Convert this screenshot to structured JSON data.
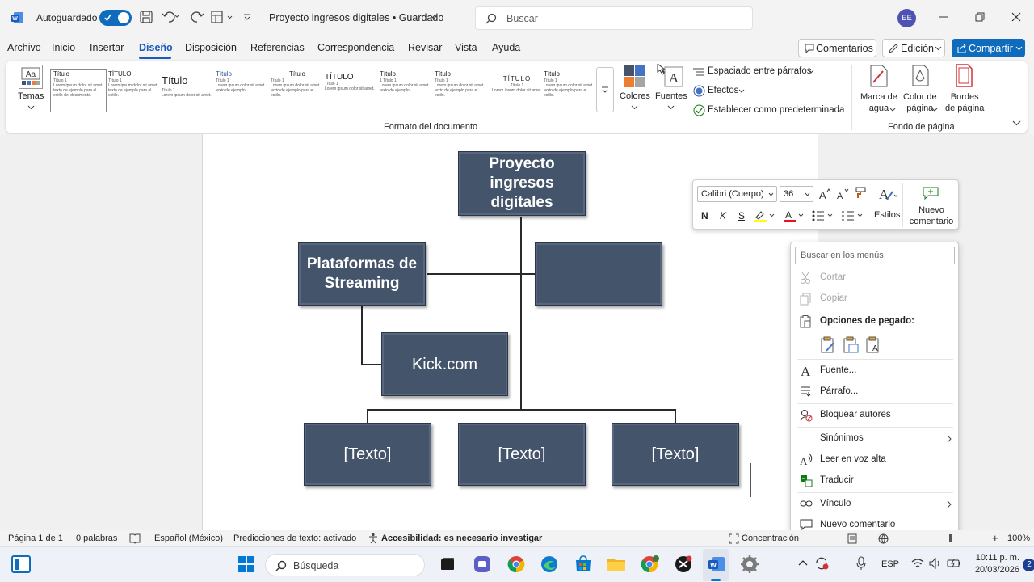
{
  "titlebar": {
    "autosave_label": "Autoguardado",
    "doc_title": "Proyecto ingresos digitales • Guardado",
    "search_placeholder": "Buscar",
    "avatar": "EE"
  },
  "menu": {
    "items": [
      "Archivo",
      "Inicio",
      "Insertar",
      "Diseño",
      "Disposición",
      "Referencias",
      "Correspondencia",
      "Revisar",
      "Vista",
      "Ayuda"
    ],
    "active": "Diseño"
  },
  "topbuttons": {
    "comments": "Comentarios",
    "editing": "Edición",
    "share": "Compartir"
  },
  "ribbon": {
    "themes_label": "Temas",
    "style_titles": [
      "Título",
      "TÍTULO",
      "Título",
      "Título",
      "Título",
      "TÍTULO",
      "Título",
      "Título",
      "TÍTULO",
      "Título"
    ],
    "doc_format_label": "Formato del documento",
    "colors_label": "Colores",
    "fonts_label": "Fuentes",
    "paragraph_spacing": "Espaciado entre párrafos",
    "effects": "Efectos",
    "set_default": "Establecer como predeterminada",
    "watermark": [
      "Marca de",
      "agua"
    ],
    "page_color": [
      "Color de",
      "página"
    ],
    "page_borders": [
      "Bordes",
      "de página"
    ],
    "page_background_label": "Fondo de página"
  },
  "chart": {
    "root": "Proyecto ingresos digitales",
    "left": "Plataformas de Streaming",
    "right": "",
    "child": "Kick.com",
    "bottom": [
      "[Texto]",
      "[Texto]",
      "[Texto]"
    ]
  },
  "mini_toolbar": {
    "font": "Calibri (Cuerpo)",
    "size": "36",
    "styles": "Estilos",
    "new_comment": [
      "Nuevo",
      "comentario"
    ],
    "bold": "N",
    "italic": "K",
    "underline": "S"
  },
  "context_menu": {
    "search_placeholder": "Buscar en los menús",
    "cut": "Cortar",
    "copy": "Copiar",
    "paste_options": "Opciones de pegado:",
    "font": "Fuente...",
    "paragraph": "Párrafo...",
    "block_authors": "Bloquear autores",
    "synonyms": "Sinónimos",
    "read_aloud": "Leer en voz alta",
    "translate": "Traducir",
    "link": "Vínculo",
    "new_comment": "Nuevo comentario"
  },
  "status": {
    "page": "Página 1 de 1",
    "words": "0 palabras",
    "language": "Español (México)",
    "predictions": "Predicciones de texto: activado",
    "accessibility": "Accesibilidad: es necesario investigar",
    "focus": "Concentración",
    "zoom": "100%"
  },
  "taskbar": {
    "search": "Búsqueda",
    "lang": "ESP",
    "time": "10:11 p. m.",
    "date": "20/03/2026",
    "badge": "2"
  },
  "colors": {
    "accent": "#185abd",
    "node": "#44546a",
    "toggle": "#0f6cbd"
  }
}
